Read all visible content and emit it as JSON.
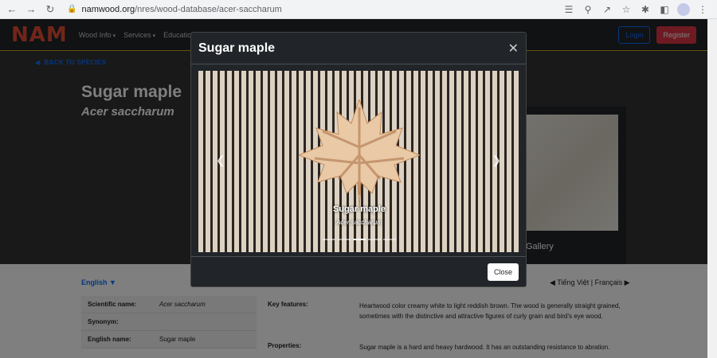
{
  "browser": {
    "url_host": "namwood.org",
    "url_path": "/nres/wood-database/acer-saccharum"
  },
  "nav": {
    "logo": "NAM",
    "links": [
      "Wood Info",
      "Services",
      "Education"
    ],
    "login": "Login",
    "register": "Register"
  },
  "hero": {
    "back": "BACK TO SPECIES",
    "title": "Sugar maple",
    "subtitle": "Acer saccharum",
    "gallery_label": "Gallery"
  },
  "content": {
    "language": "English",
    "other_languages": "Tiếng Việt | Français",
    "info": [
      {
        "key": "Scientific name:",
        "value": "Acer saccharum"
      },
      {
        "key": "Synonym:",
        "value": ""
      },
      {
        "key": "English name:",
        "value": "Sugar maple"
      }
    ],
    "features": [
      {
        "key": "Key features:",
        "value": "Heartwood color creamy white to light reddish brown. The wood is generally straight grained, sometimes with the distinctive and attractive figures of curly grain and bird's eye wood."
      },
      {
        "key": "Properties:",
        "value": "Sugar maple is a hard and heavy hardwood. It has an outstanding resistance to abration."
      }
    ]
  },
  "modal": {
    "title": "Sugar maple",
    "caption_title": "Sugar maple",
    "caption_sub": "Acer saccharum",
    "close_button": "Close",
    "slide_count": 5,
    "active_slide": 3
  },
  "colors": {
    "accent_blue": "#0d6efd",
    "register_red": "#dc3545",
    "logo_red": "#e24a33"
  }
}
